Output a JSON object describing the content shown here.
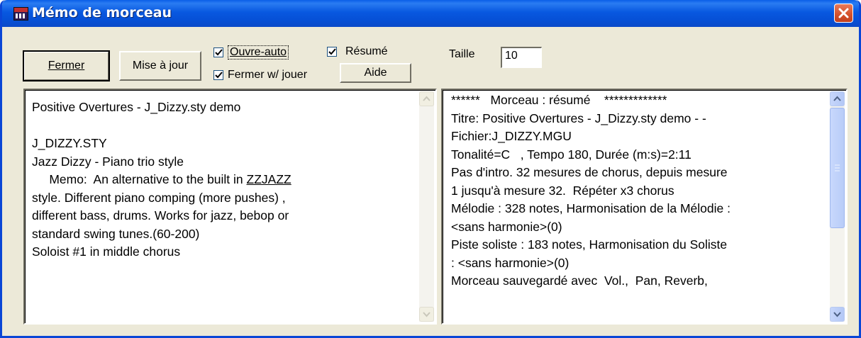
{
  "window": {
    "title": "Mémo de morceau"
  },
  "toolbar": {
    "fermer": "Fermer",
    "mise_a_jour": "Mise à jour",
    "ouvre_auto": "Ouvre-auto",
    "fermer_w_jouer": "Fermer w/ jouer",
    "resume": "Résumé",
    "aide": "Aide",
    "taille_label": "Taille",
    "taille_value": "10",
    "ouvre_auto_checked": true,
    "fermer_w_jouer_checked": true,
    "resume_checked": true
  },
  "memo": {
    "lines": [
      "Positive Overtures - J_Dizzy.sty demo",
      "",
      "J_DIZZY.STY",
      "Jazz Dizzy - Piano trio style",
      "     Memo:  An alternative to the built in ZZJAZZ",
      "style. Different piano comping (more pushes) ,",
      "different bass, drums. Works for jazz, bebop or",
      "standard swing tunes.(60-200)",
      "Soloist #1 in middle chorus"
    ]
  },
  "summary": {
    "lines": [
      "******   Morceau : résumé    *************",
      "Titre: Positive Overtures - J_Dizzy.sty demo - -",
      "Fichier:J_DIZZY.MGU",
      "Tonalité=C   , Tempo 180, Durée (m:s)=2:11",
      "Pas d'intro. 32 mesures de chorus, depuis mesure",
      "1 jusqu'à mesure 32.  Répéter x3 chorus",
      "Mélodie : 328 notes, Harmonisation de la Mélodie :",
      "<sans harmonie>(0)",
      "Piste soliste : 183 notes, Harmonisation du Soliste",
      ": <sans harmonie>(0)",
      "Morceau sauvegardé avec  Vol.,  Pan, Reverb,"
    ]
  }
}
